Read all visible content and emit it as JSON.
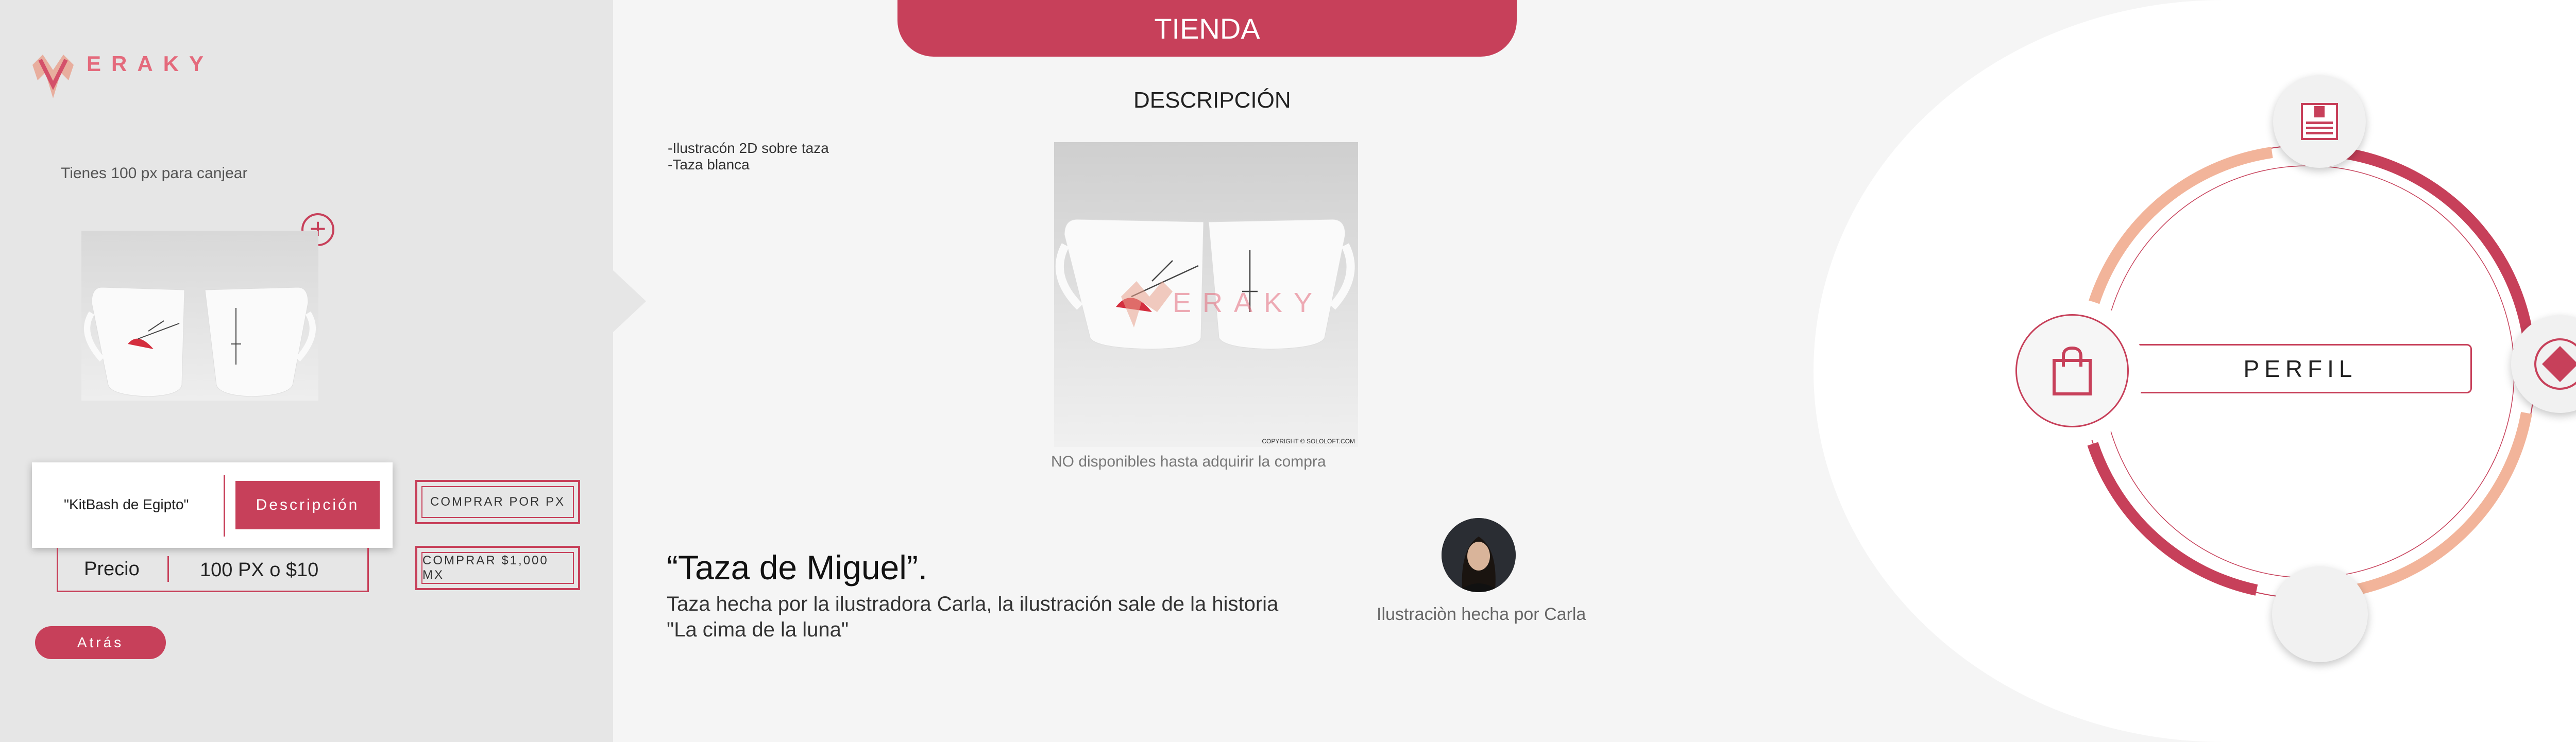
{
  "brand": {
    "name": "ERAKY",
    "accent": "#c7405a",
    "accent_light": "#f2b49a"
  },
  "left": {
    "points_text": "Tienes 100 px para canjear",
    "add_icon": "plus-icon",
    "product_name": "\"KitBash de Egipto\"",
    "description_button": "Descripción",
    "price_label": "Precio",
    "price_value": "100 PX o $10",
    "buy_px_button": "COMPRAR POR PX",
    "buy_mx_button": "COMPRAR $1,000 MX",
    "back_button": "Atrás"
  },
  "center": {
    "tab_title": "TIENDA",
    "heading": "DESCRIPCIÓN",
    "description_lines": [
      "-Ilustracón 2D sobre taza",
      "-Taza blanca"
    ],
    "watermark": "ERAKY",
    "copyright": "COPYRIGHT © SOLOLOFT.COM",
    "availability": "NO disponibles hasta adquirir la compra",
    "mug_title": "“Taza de Miguel”.",
    "mug_description": "Taza hecha por la ilustradora Carla, la ilustración sale de la historia \"La cima de la luna\"",
    "artist_caption": "Ilustraciòn hecha por Carla"
  },
  "right": {
    "profile_label": "PERFIL",
    "icons": {
      "top": "document-icon",
      "left": "shopping-bag-icon",
      "right": "diamond-icon",
      "bottom": "blank-circle"
    }
  }
}
